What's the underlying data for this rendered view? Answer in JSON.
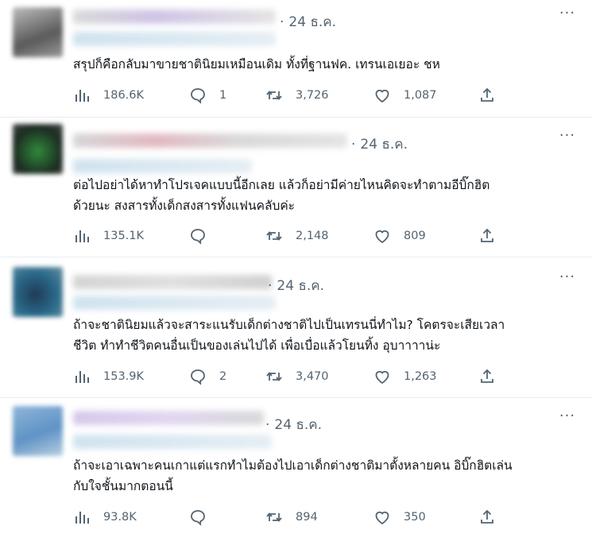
{
  "tweets": [
    {
      "date": "24 ธ.ค.",
      "text": "สรุปก็คือกลับมาขายชาตินิยมเหมือนเดิม ทั้งที่ฐานฟค. เทรนเอเยอะ ชห",
      "views": "186.6K",
      "replies": "1",
      "retweets": "3,726",
      "likes": "1,087"
    },
    {
      "date": "24 ธ.ค.",
      "text": "ต่อไปอย่าได้หาทำโปรเจคแบบนี้อีกเลย แล้วก็อย่ามีค่ายไหนคิดจะทำตามอีบิ๊กฮิต\nด้วยนะ สงสารทั้งเด็กสงสารทั้งแฟนคลับค่ะ",
      "views": "135.1K",
      "replies": "",
      "retweets": "2,148",
      "likes": "809"
    },
    {
      "date": "24 ธ.ค.",
      "text": "ถ้าจะชาตินิยมแล้วจะสาระแนรับเด็กต่างชาติไปเป็นเทรนนี่ทำไม? โคตรจะเสียเวลา\nชีวิต ทำทำชีวิตคนอื่นเป็นของเล่นไปได้ เพื่อเบื่อแล้วโยนทิ้ง อุบาาาาน่ะ",
      "views": "153.9K",
      "replies": "2",
      "retweets": "3,470",
      "likes": "1,263"
    },
    {
      "date": "24 ธ.ค.",
      "text": "ถ้าจะเอาเฉพาะคนเกาแต่แรกทำไมต้องไปเอาเด็กต่างชาติมาตั้งหลายคน อิบิ๊กฮิตเล่น\nกับใจชั้นมากตอนนี้",
      "views": "93.8K",
      "replies": "",
      "retweets": "894",
      "likes": "350"
    }
  ],
  "icons": {
    "views": "bar-chart-icon",
    "reply": "speech-bubble-icon",
    "retweet": "retweet-icon",
    "like": "heart-icon",
    "share": "share-upload-icon",
    "more": "more-dots-icon"
  },
  "colors": {
    "text": "#0f1419",
    "muted": "#536471",
    "divider": "#e8ecef"
  }
}
